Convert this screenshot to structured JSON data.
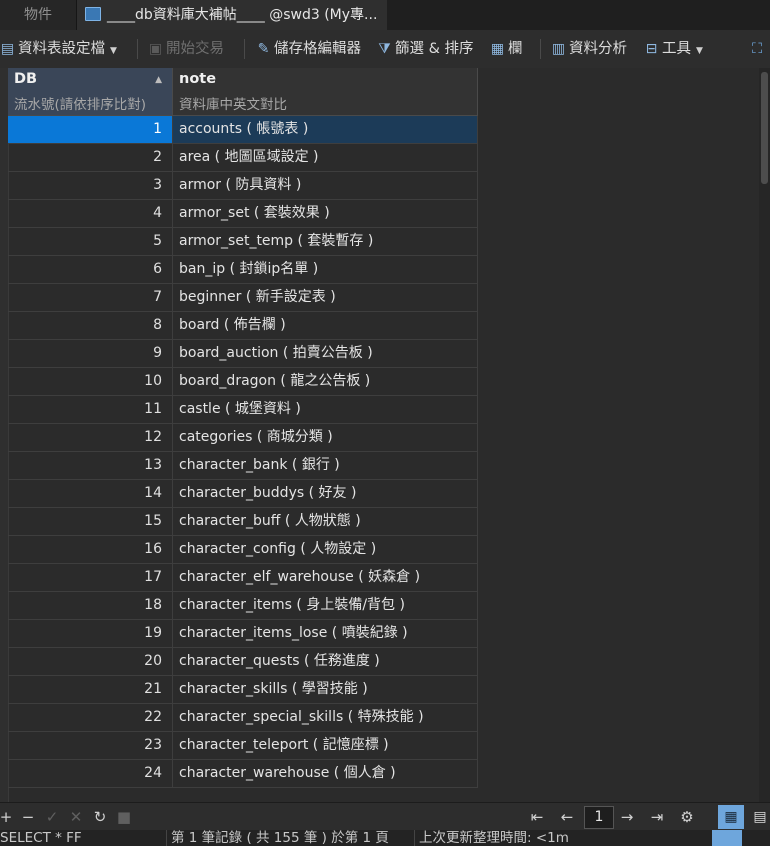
{
  "tabs": [
    {
      "label": "物件"
    },
    {
      "label": "____db資料庫大補帖____ @swd3 (My專..."
    }
  ],
  "toolbar": {
    "table_config": "資料表設定檔",
    "begin_transaction": "開始交易",
    "cell_editor": "儲存格編輯器",
    "filter_sort": "篩選 & 排序",
    "columns": "欄",
    "data_analysis": "資料分析",
    "tools": "工具"
  },
  "grid": {
    "columns": [
      {
        "name": "DB",
        "comment": "流水號(請依排序比對)"
      },
      {
        "name": "note",
        "comment": "資料庫中英文對比"
      }
    ],
    "rows": [
      {
        "db": "1",
        "note": "accounts ( 帳號表 )"
      },
      {
        "db": "2",
        "note": "area ( 地圖區域設定 )"
      },
      {
        "db": "3",
        "note": "armor ( 防具資料 )"
      },
      {
        "db": "4",
        "note": "armor_set ( 套裝效果 )"
      },
      {
        "db": "5",
        "note": "armor_set_temp ( 套裝暫存 )"
      },
      {
        "db": "6",
        "note": "ban_ip ( 封鎖ip名單 )"
      },
      {
        "db": "7",
        "note": "beginner ( 新手設定表 )"
      },
      {
        "db": "8",
        "note": "board ( 佈告欄 )"
      },
      {
        "db": "9",
        "note": "board_auction ( 拍賣公告板 )"
      },
      {
        "db": "10",
        "note": "board_dragon ( 龍之公告板 )"
      },
      {
        "db": "11",
        "note": "castle ( 城堡資料 )"
      },
      {
        "db": "12",
        "note": "categories ( 商城分類 )"
      },
      {
        "db": "13",
        "note": "character_bank ( 銀行 )"
      },
      {
        "db": "14",
        "note": "character_buddys ( 好友 )"
      },
      {
        "db": "15",
        "note": "character_buff ( 人物狀態 )"
      },
      {
        "db": "16",
        "note": "character_config ( 人物設定 )"
      },
      {
        "db": "17",
        "note": "character_elf_warehouse ( 妖森倉 )"
      },
      {
        "db": "18",
        "note": "character_items ( 身上裝備/背包 )"
      },
      {
        "db": "19",
        "note": "character_items_lose ( 噴裝紀錄 )"
      },
      {
        "db": "20",
        "note": "character_quests ( 任務進度 )"
      },
      {
        "db": "21",
        "note": "character_skills ( 學習技能 )"
      },
      {
        "db": "22",
        "note": "character_special_skills ( 特殊技能 )"
      },
      {
        "db": "23",
        "note": "character_teleport ( 記憶座標 )"
      },
      {
        "db": "24",
        "note": "character_warehouse ( 個人倉 )"
      }
    ],
    "selected_row": 1
  },
  "nav": {
    "page": "1"
  },
  "status": {
    "sql": "SELECT * FF",
    "record_info": "第 1 筆記錄 ( 共 155 筆 ) 於第 1 頁",
    "refresh_time": "上次更新整理時間: <1m"
  },
  "colors": {
    "selected_cell": "#0a78d7",
    "selected_row": "#1c3b58",
    "active_button": "#6ea6dc"
  }
}
